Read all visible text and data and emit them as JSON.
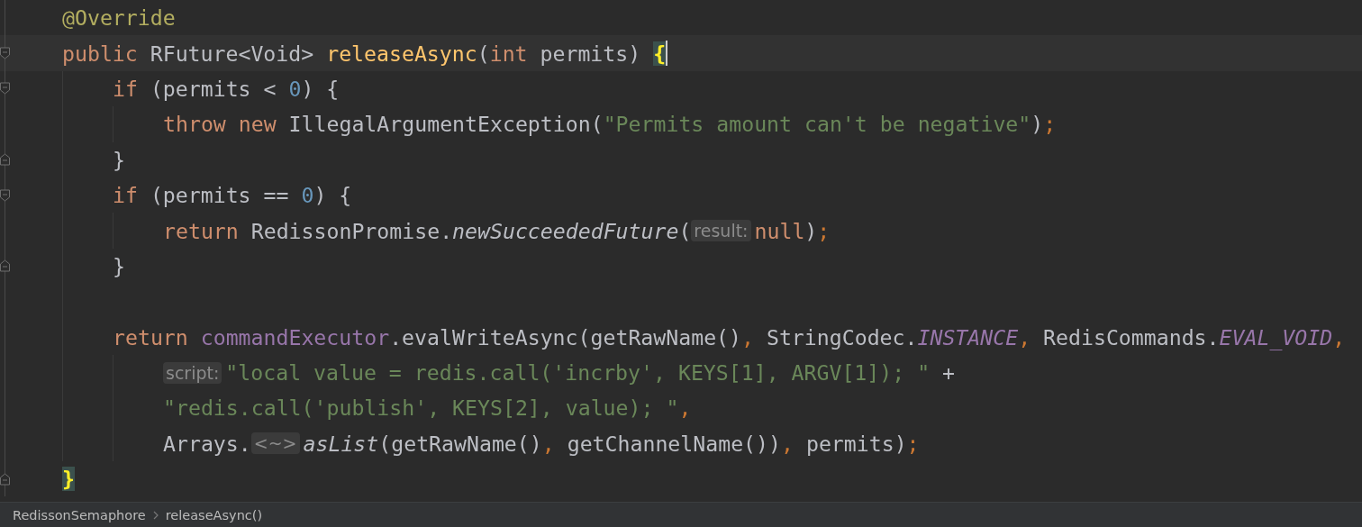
{
  "editor": {
    "lines": [
      {
        "fold_open": false,
        "fold_close": false,
        "current": false,
        "tokens": [
          {
            "kind": "annotation",
            "text": "@Override"
          }
        ]
      },
      {
        "fold_open": true,
        "fold_close": false,
        "current": true,
        "tokens": [
          {
            "kind": "keyword",
            "text": "public "
          },
          {
            "kind": "plain",
            "text": "RFuture<Void> "
          },
          {
            "kind": "declaration",
            "text": "releaseAsync"
          },
          {
            "kind": "plain",
            "text": "("
          },
          {
            "kind": "keyword",
            "text": "int "
          },
          {
            "kind": "plain",
            "text": "permits) "
          },
          {
            "kind": "brace-match",
            "text": "{"
          }
        ],
        "children": [
          {
            "fold_open": true,
            "fold_close": false,
            "current": false,
            "tokens": [
              {
                "kind": "keyword",
                "text": "if "
              },
              {
                "kind": "plain",
                "text": "(permits < "
              },
              {
                "kind": "number",
                "text": "0"
              },
              {
                "kind": "plain",
                "text": ") {"
              }
            ],
            "children": [
              {
                "fold_open": false,
                "fold_close": false,
                "current": false,
                "tokens": [
                  {
                    "kind": "keyword",
                    "text": "throw new "
                  },
                  {
                    "kind": "plain",
                    "text": "IllegalArgumentException("
                  },
                  {
                    "kind": "string",
                    "text": "\"Permits amount can't be negative\""
                  },
                  {
                    "kind": "plain",
                    "text": ")"
                  },
                  {
                    "kind": "punct",
                    "text": ";"
                  }
                ]
              }
            ]
          },
          {
            "fold_open": false,
            "fold_close": true,
            "current": false,
            "tokens": [
              {
                "kind": "plain",
                "text": "}"
              }
            ]
          },
          {
            "fold_open": true,
            "fold_close": false,
            "current": false,
            "tokens": [
              {
                "kind": "keyword",
                "text": "if "
              },
              {
                "kind": "plain",
                "text": "(permits == "
              },
              {
                "kind": "number",
                "text": "0"
              },
              {
                "kind": "plain",
                "text": ") {"
              }
            ],
            "children": [
              {
                "fold_open": false,
                "fold_close": false,
                "current": false,
                "tokens": [
                  {
                    "kind": "keyword",
                    "text": "return "
                  },
                  {
                    "kind": "plain",
                    "text": "RedissonPromise."
                  },
                  {
                    "kind": "static-method",
                    "text": "newSucceededFuture"
                  },
                  {
                    "kind": "plain",
                    "text": "("
                  },
                  {
                    "kind": "hint",
                    "text": "result:"
                  },
                  {
                    "kind": "keyword",
                    "text": "null"
                  },
                  {
                    "kind": "plain",
                    "text": ")"
                  },
                  {
                    "kind": "punct",
                    "text": ";"
                  }
                ]
              }
            ]
          },
          {
            "fold_open": false,
            "fold_close": true,
            "current": false,
            "tokens": [
              {
                "kind": "plain",
                "text": "}"
              }
            ]
          },
          {
            "fold_open": false,
            "fold_close": false,
            "current": false
          },
          {
            "fold_open": false,
            "fold_close": false,
            "current": false,
            "tokens": [
              {
                "kind": "keyword",
                "text": "return "
              },
              {
                "kind": "field",
                "text": "commandExecutor"
              },
              {
                "kind": "plain",
                "text": ".evalWriteAsync(getRawName()"
              },
              {
                "kind": "punct",
                "text": ", "
              },
              {
                "kind": "plain",
                "text": "StringCodec."
              },
              {
                "kind": "static-field",
                "text": "INSTANCE"
              },
              {
                "kind": "punct",
                "text": ", "
              },
              {
                "kind": "plain",
                "text": "RedisCommands."
              },
              {
                "kind": "static-field",
                "text": "EVAL_VOID"
              },
              {
                "kind": "punct",
                "text": ","
              }
            ],
            "children": [
              {
                "fold_open": false,
                "fold_close": false,
                "current": false,
                "tokens": [
                  {
                    "kind": "hint",
                    "text": "script:"
                  },
                  {
                    "kind": "string",
                    "text": "\"local value = redis.call('incrby', KEYS[1], ARGV[1]); \""
                  },
                  {
                    "kind": "plain",
                    "text": " +"
                  }
                ]
              },
              {
                "fold_open": false,
                "fold_close": false,
                "current": false,
                "tokens": [
                  {
                    "kind": "string",
                    "text": "\"redis.call('publish', KEYS[2], value); \""
                  },
                  {
                    "kind": "punct",
                    "text": ","
                  }
                ]
              },
              {
                "fold_open": false,
                "fold_close": false,
                "current": false,
                "tokens": [
                  {
                    "kind": "plain",
                    "text": "Arrays."
                  },
                  {
                    "kind": "hint",
                    "text": "<~>"
                  },
                  {
                    "kind": "static-method",
                    "text": "asList"
                  },
                  {
                    "kind": "plain",
                    "text": "(getRawName()"
                  },
                  {
                    "kind": "punct",
                    "text": ", "
                  },
                  {
                    "kind": "plain",
                    "text": "getChannelName())"
                  },
                  {
                    "kind": "punct",
                    "text": ", "
                  },
                  {
                    "kind": "plain",
                    "text": "permits)"
                  },
                  {
                    "kind": "punct",
                    "text": ";"
                  }
                ]
              }
            ]
          }
        ]
      },
      {
        "fold_open": false,
        "fold_close": true,
        "current": false,
        "tokens": [
          {
            "kind": "brace-match",
            "text": "}"
          }
        ]
      }
    ]
  },
  "breadcrumbs": [
    "RedissonSemaphore",
    "releaseAsync()"
  ]
}
